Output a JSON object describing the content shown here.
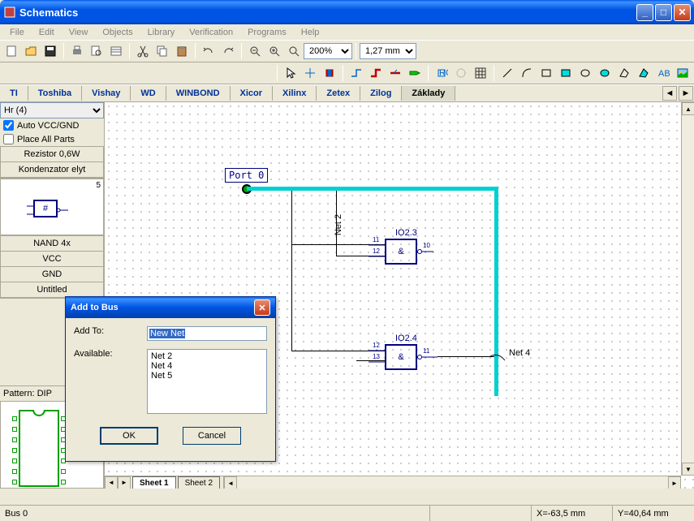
{
  "window": {
    "title": "Schematics"
  },
  "menu": {
    "file": "File",
    "edit": "Edit",
    "view": "View",
    "objects": "Objects",
    "library": "Library",
    "verification": "Verification",
    "programs": "Programs",
    "help": "Help"
  },
  "toolbar": {
    "zoom_value": "200%",
    "grid_value": "1,27 mm"
  },
  "tabs": {
    "items": [
      "TI",
      "Toshiba",
      "Vishay",
      "WD",
      "WINBOND",
      "Xicor",
      "Xilinx",
      "Zetex",
      "Zilog",
      "Základy"
    ],
    "active": 9
  },
  "sidebar": {
    "selector": "Hr (4)",
    "auto_vcc_gnd": "Auto VCC/GND",
    "place_all": "Place All Parts",
    "parts": [
      "Rezistor 0,6W",
      "Kondenzator elyt",
      "NAND 4x",
      "VCC",
      "GND",
      "Untitled"
    ],
    "pin_count": "5",
    "pattern_label": "Pattern: DIP"
  },
  "schematic": {
    "port0": "Port 0",
    "gate1_ref": "IO2.3",
    "gate2_ref": "IO2.4",
    "net_vert": "Net 2",
    "net_right": "Net 4",
    "gate_symbol": "&",
    "pins": {
      "g1_a": "11",
      "g1_b": "12",
      "g1_y": "10",
      "g2_a": "12",
      "g2_b": "13",
      "g2_y": "11"
    }
  },
  "sheets": {
    "s1": "Sheet 1",
    "s2": "Sheet 2"
  },
  "dialog": {
    "title": "Add to Bus",
    "addto_label": "Add To:",
    "addto_value": "New Net",
    "available_label": "Available:",
    "available": [
      "Net 2",
      "Net 4",
      "Net 5"
    ],
    "ok": "OK",
    "cancel": "Cancel"
  },
  "status": {
    "left": "Bus 0",
    "x": "X=-63,5 mm",
    "y": "Y=40,64 mm"
  }
}
